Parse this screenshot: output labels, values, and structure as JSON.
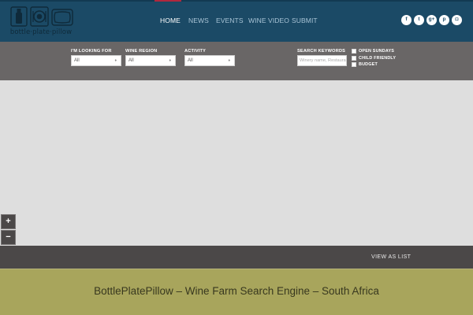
{
  "header": {
    "logo_text": "bottle·plate·pillow",
    "nav": [
      {
        "label": "HOME",
        "active": true
      },
      {
        "label": "NEWS",
        "active": false
      },
      {
        "label": "EVENTS",
        "active": false
      },
      {
        "label": "WINE VIDEO",
        "active": false
      },
      {
        "label": "SUBMIT",
        "active": false
      }
    ],
    "social": [
      {
        "icon": "facebook-icon",
        "glyph": "f"
      },
      {
        "icon": "twitter-icon",
        "glyph": "t"
      },
      {
        "icon": "google-plus-icon",
        "glyph": "g+"
      },
      {
        "icon": "pinterest-icon",
        "glyph": "p"
      },
      {
        "icon": "instagram-icon",
        "glyph": "◘"
      }
    ]
  },
  "filters": {
    "looking_for": {
      "label": "I'M LOOKING FOR",
      "value": "All"
    },
    "wine_region": {
      "label": "WINE REGION",
      "value": "All"
    },
    "activity": {
      "label": "ACTIVITY",
      "value": "All"
    },
    "search": {
      "label": "SEARCH KEYWORDS",
      "placeholder": "Winery name, Restaurant"
    },
    "checkboxes": [
      {
        "label": "OPEN SUNDAYS",
        "checked": false
      },
      {
        "label": "CHILD FRIENDLY",
        "checked": false
      },
      {
        "label": "BUDGET",
        "checked": false
      }
    ]
  },
  "map": {
    "zoom_in": "+",
    "zoom_out": "−"
  },
  "list_bar": {
    "view_as_list": "VIEW AS LIST"
  },
  "footer": {
    "title": "BottlePlatePillow – Wine Farm Search Engine – South Africa"
  },
  "colors": {
    "header": "#1b4a66",
    "active_marker": "#b0283d",
    "filter_bar": "#696666",
    "map": "#dedede",
    "list_bar": "#4b4848",
    "footer": "#a8a55c"
  }
}
